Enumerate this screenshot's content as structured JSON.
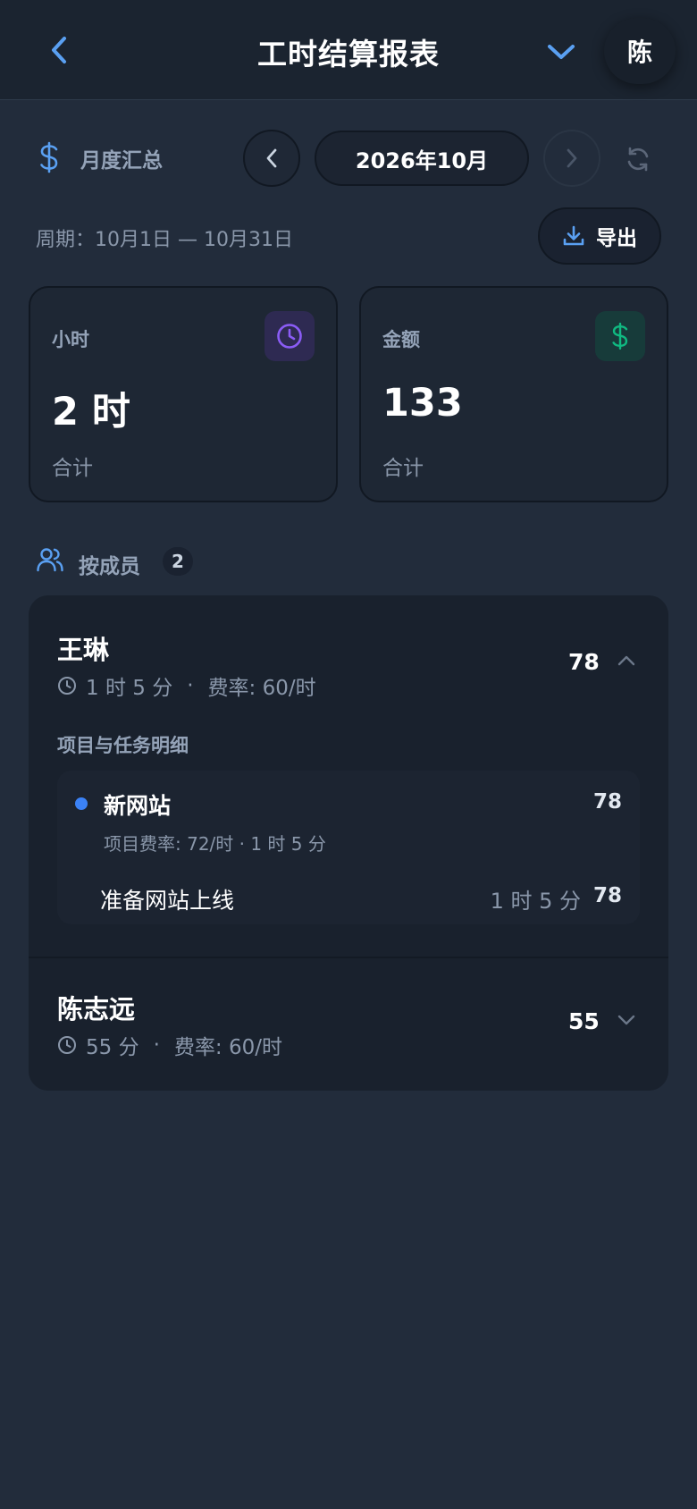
{
  "header": {
    "title": "工时结算报表",
    "avatar_initial": "陈"
  },
  "summary": {
    "label": "月度汇总",
    "month": "2026年10月",
    "period": "周期：10月1日 — 10月31日",
    "export_label": "导出"
  },
  "stats": {
    "hours": {
      "label": "小时",
      "value": "2 时",
      "sub": "合计"
    },
    "amount": {
      "label": "金额",
      "value": "133",
      "sub": "合计"
    }
  },
  "members": {
    "label": "按成员",
    "count": "2",
    "items": [
      {
        "name": "王琳",
        "duration": "1 时 5 分",
        "separator": "·",
        "rate": "费率: 60/时",
        "amount": "78",
        "expanded": true,
        "details_title": "项目与任务明细",
        "project": {
          "name": "新网站",
          "amount": "78",
          "meta": "项目费率: 72/时 · 1 时 5 分",
          "task": {
            "name": "准备网站上线",
            "time": "1 时 5 分",
            "amount": "78"
          }
        }
      },
      {
        "name": "陈志远",
        "duration": "55 分",
        "separator": "·",
        "rate": "费率: 60/时",
        "amount": "55",
        "expanded": false
      }
    ]
  },
  "colors": {
    "background": "#222c3b",
    "accent_blue": "#5aa0f2",
    "purple": "#8b5cf6",
    "green": "#10b981",
    "project_dot": "#3b82f6"
  }
}
